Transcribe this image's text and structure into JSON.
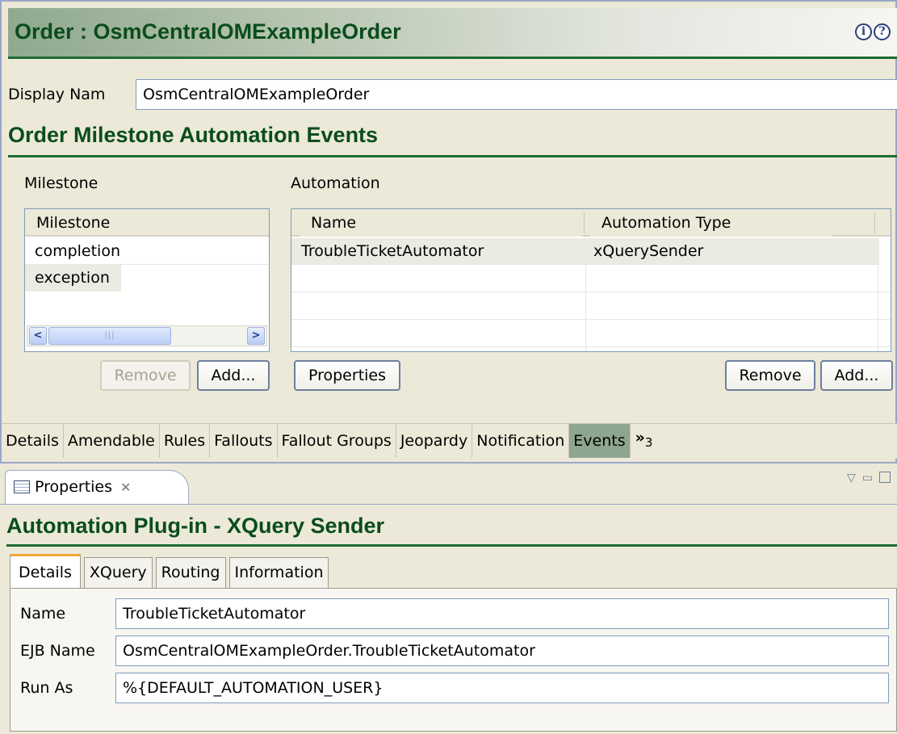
{
  "editor": {
    "title": "Order : OsmCentralOMExampleOrder",
    "help_icons": [
      "info-icon",
      "question-icon"
    ],
    "display_name_label": "Display Nam",
    "display_name_value": "OsmCentralOMExampleOrder",
    "section_title": "Order Milestone Automation Events",
    "milestone_group_label": "Milestone",
    "automation_group_label": "Automation",
    "milestone_table": {
      "header": "Milestone",
      "rows": [
        "completion",
        "exception"
      ]
    },
    "automation_table": {
      "headers": [
        "Name",
        "Automation Type"
      ],
      "rows": [
        {
          "name": "TroubleTicketAutomator",
          "type": "xQuerySender"
        }
      ]
    },
    "buttons": {
      "milestone_remove": "Remove",
      "milestone_add": "Add...",
      "properties": "Properties",
      "automation_remove": "Remove",
      "automation_add": "Add..."
    },
    "tabs": [
      "Details",
      "Amendable",
      "Rules",
      "Fallouts",
      "Fallout Groups",
      "Jeopardy",
      "Notification",
      "Events"
    ],
    "active_tab": "Events",
    "more_tabs": {
      "glyph": "»",
      "count": "3"
    }
  },
  "properties_view": {
    "tab_label": "Properties",
    "title": "Automation Plug-in - XQuery Sender",
    "tabs": [
      "Details",
      "XQuery",
      "Routing",
      "Information"
    ],
    "active_tab": "Details",
    "fields": {
      "name_label": "Name",
      "name_value": "TroubleTicketAutomator",
      "ejb_label": "EJB Name",
      "ejb_value": "OsmCentralOMExampleOrder.TroubleTicketAutomator",
      "runas_label": "Run As",
      "runas_value": "%{DEFAULT_AUTOMATION_USER}"
    }
  },
  "colors": {
    "title_green": "#0a4d1c",
    "active_tab_bg": "#8ea58f",
    "tab_accent": "#f2a73b"
  }
}
